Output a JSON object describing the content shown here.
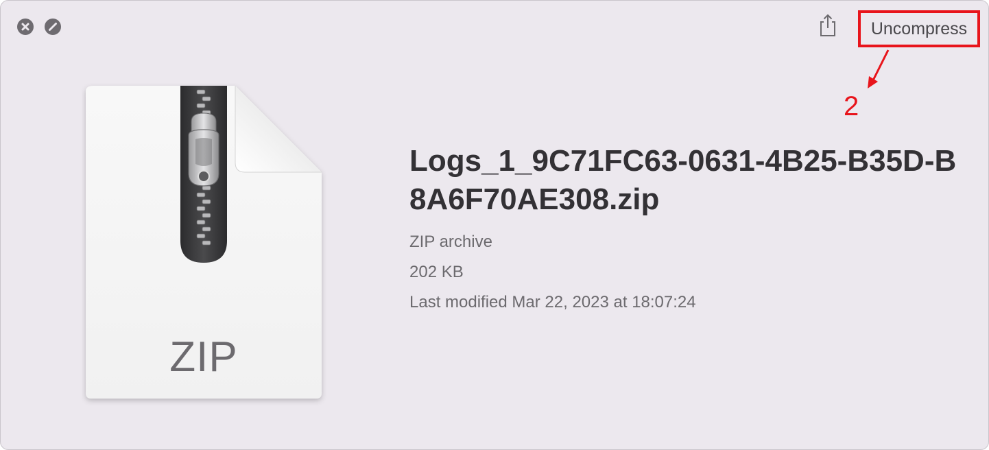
{
  "window": {
    "controls": {
      "close_icon": "close-icon",
      "fullscreen_icon": "fullscreen-icon"
    },
    "toolbar": {
      "share_icon": "share-icon",
      "uncompress_label": "Uncompress"
    }
  },
  "annotation": {
    "step_number": "2",
    "color": "#e8141b"
  },
  "file": {
    "icon_name": "zip-archive-icon",
    "icon_label": "ZIP",
    "name": "Logs_1_9C71FC63-0631-4B25-B35D-B8A6F70AE308.zip",
    "kind": "ZIP archive",
    "size": "202 KB",
    "modified": "Last modified Mar 22, 2023 at 18:07:24"
  }
}
